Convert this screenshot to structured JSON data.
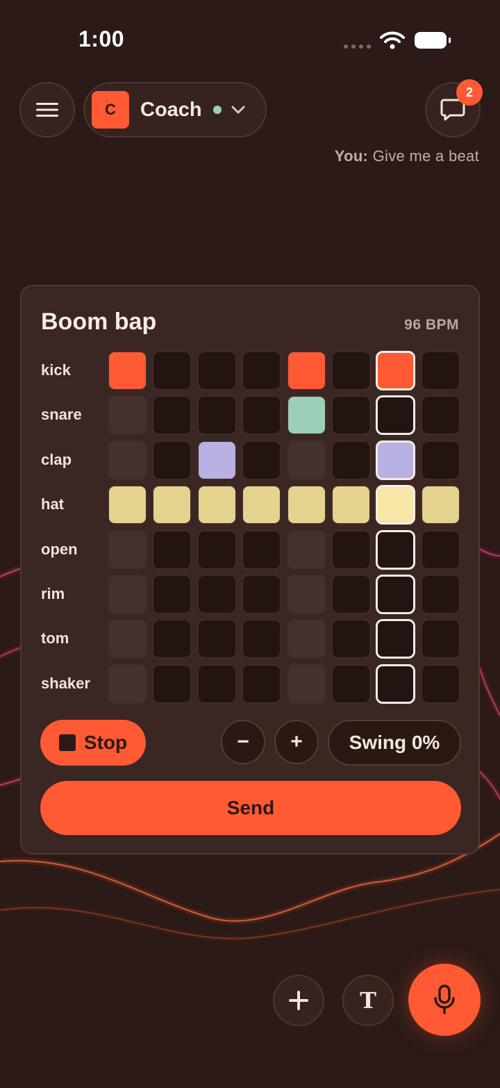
{
  "status_bar": {
    "time": "1:00"
  },
  "header": {
    "coach_initial": "C",
    "coach_name": "Coach",
    "chat_badge_count": "2",
    "last_message_sender": "You:",
    "last_message_text": "Give me a beat"
  },
  "sequencer": {
    "title": "Boom bap",
    "bpm_label": "96 BPM",
    "current_step": 6,
    "rows": [
      {
        "name": "kick",
        "color": "#ff5a33",
        "steps": [
          1,
          0,
          0,
          0,
          1,
          0,
          1,
          0
        ]
      },
      {
        "name": "snare",
        "color": "#9ccfb8",
        "steps": [
          0,
          0,
          0,
          0,
          1,
          0,
          0,
          0
        ]
      },
      {
        "name": "clap",
        "color": "#b9b0e3",
        "steps": [
          0,
          0,
          1,
          0,
          0,
          0,
          1,
          0
        ]
      },
      {
        "name": "hat",
        "color": "#e6d28f",
        "steps": [
          1,
          1,
          1,
          1,
          1,
          1,
          1,
          1
        ]
      },
      {
        "name": "open",
        "color": "#e6d28f",
        "steps": [
          0,
          0,
          0,
          0,
          0,
          0,
          0,
          0
        ]
      },
      {
        "name": "rim",
        "color": "#e6d28f",
        "steps": [
          0,
          0,
          0,
          0,
          0,
          0,
          0,
          0
        ]
      },
      {
        "name": "tom",
        "color": "#e6d28f",
        "steps": [
          0,
          0,
          0,
          0,
          0,
          0,
          0,
          0
        ]
      },
      {
        "name": "shaker",
        "color": "#e6d28f",
        "steps": [
          0,
          0,
          0,
          0,
          0,
          0,
          0,
          0
        ]
      }
    ],
    "stop_label": "Stop",
    "minus_label": "−",
    "plus_label": "+",
    "swing_label": "Swing 0%",
    "send_label": "Send"
  },
  "bottom_bar": {
    "text_mode_label": "T"
  },
  "icons": {
    "menu": "hamburger-icon",
    "dropdown": "chevron-down-icon",
    "chat": "chat-bubble-icon",
    "add": "plus-icon",
    "text": "text-icon",
    "mic": "microphone-icon"
  },
  "colors": {
    "accent": "#ff5a33",
    "background": "#2b1a17",
    "online": "#9ccfb8"
  }
}
